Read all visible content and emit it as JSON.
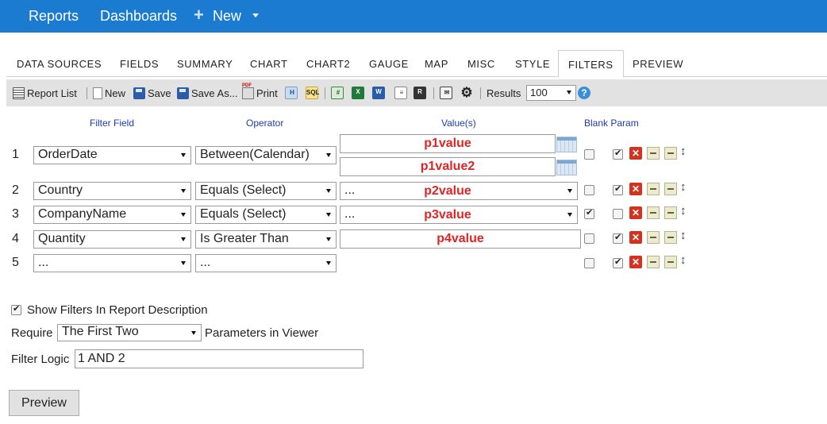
{
  "topnav": {
    "reports": "Reports",
    "dashboards": "Dashboards",
    "new_label": "New"
  },
  "tabs": [
    "DATA SOURCES",
    "FIELDS",
    "SUMMARY",
    "CHART",
    "CHART2",
    "GAUGE",
    "MAP",
    "MISC",
    "STYLE",
    "FILTERS",
    "PREVIEW"
  ],
  "active_tab": "FILTERS",
  "toolbar": {
    "report_list": "Report List",
    "new": "New",
    "save": "Save",
    "save_as": "Save As...",
    "print": "Print",
    "results_label": "Results",
    "results_value": "100",
    "export_icons": [
      "html-icon",
      "sql-icon",
      "excel-grid-icon",
      "excel-icon",
      "word-icon",
      "text-icon",
      "rtf-icon",
      "email-icon",
      "gear-icon"
    ]
  },
  "headers": {
    "filter_field": "Filter Field",
    "operator": "Operator",
    "values": "Value(s)",
    "blank_param": "Blank Param"
  },
  "rows": [
    {
      "num": "1",
      "field": "OrderDate",
      "operator": "Between(Calendar)",
      "value": "p1value",
      "value2": "p1value2",
      "blank": false,
      "enabled": true
    },
    {
      "num": "2",
      "field": "Country",
      "operator": "Equals (Select)",
      "value_prefix": "...",
      "value": "p2value",
      "blank": false,
      "enabled": true
    },
    {
      "num": "3",
      "field": "CompanyName",
      "operator": "Equals (Select)",
      "value_prefix": "...",
      "value": "p3value",
      "blank": true,
      "enabled": false
    },
    {
      "num": "4",
      "field": "Quantity",
      "operator": "Is Greater Than",
      "value": "p4value",
      "blank": false,
      "enabled": true
    },
    {
      "num": "5",
      "field": "...",
      "operator": "...",
      "blank": false,
      "enabled": true
    }
  ],
  "options": {
    "show_filters_label": "Show Filters In Report Description",
    "show_filters_checked": true,
    "require_label": "Require",
    "require_value": "The First Two",
    "parameters_label": "Parameters in Viewer",
    "filter_logic_label": "Filter Logic",
    "filter_logic_value": "1 AND 2"
  },
  "preview_button": "Preview",
  "colors": {
    "topbar": "#1a7bd0",
    "param_value": "#e02424",
    "header_text": "#1e3bb0",
    "toolbar_bg": "#e2e2e2"
  }
}
